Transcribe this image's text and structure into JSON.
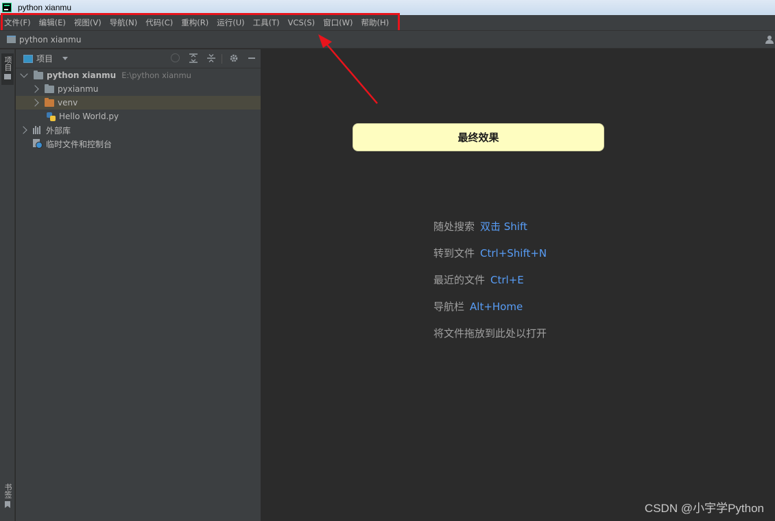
{
  "window": {
    "title": "python xianmu"
  },
  "menu": {
    "items": [
      "文件(F)",
      "编辑(E)",
      "视图(V)",
      "导航(N)",
      "代码(C)",
      "重构(R)",
      "运行(U)",
      "工具(T)",
      "VCS(S)",
      "窗口(W)",
      "帮助(H)"
    ]
  },
  "navbar": {
    "breadcrumb": "python xianmu"
  },
  "toolstrip": {
    "project_tab": "项目",
    "bookmarks_tab": "书签"
  },
  "project_panel": {
    "title": "项目",
    "tree": {
      "root": {
        "label": "python xianmu",
        "path": "E:\\python xianmu"
      },
      "pyxianmu": "pyxianmu",
      "venv": "venv",
      "file": "Hello World.py",
      "external_libs": "外部库",
      "scratches": "临时文件和控制台"
    }
  },
  "editor": {
    "callout": "最终效果",
    "hints": [
      {
        "label": "随处搜索",
        "shortcut": "双击 Shift"
      },
      {
        "label": "转到文件",
        "shortcut": "Ctrl+Shift+N"
      },
      {
        "label": "最近的文件",
        "shortcut": "Ctrl+E"
      },
      {
        "label": "导航栏",
        "shortcut": "Alt+Home"
      },
      {
        "label": "将文件拖放到此处以打开",
        "shortcut": ""
      }
    ],
    "watermark": "CSDN @小宇学Python"
  },
  "colors": {
    "annotation_red": "#e8141c",
    "shortcut_blue": "#589df6",
    "callout_yellow": "#fefdc0"
  }
}
